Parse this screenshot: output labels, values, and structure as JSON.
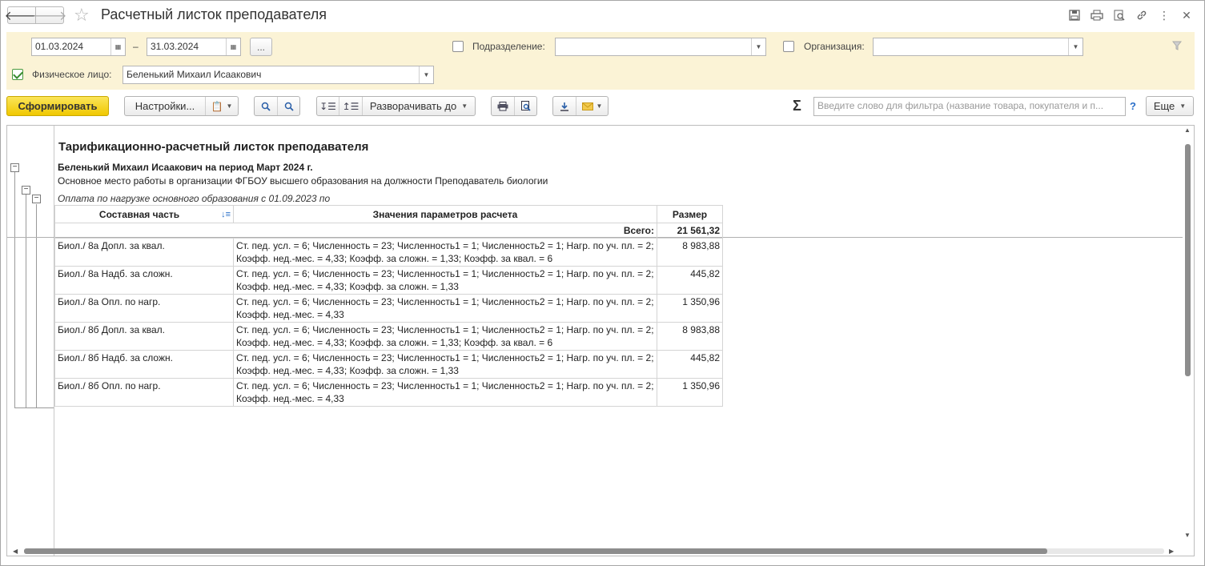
{
  "window": {
    "title": "Расчетный листок преподавателя"
  },
  "filters": {
    "date_from": "01.03.2024",
    "date_separator": "–",
    "date_to": "31.03.2024",
    "period_button": "...",
    "subdivision_label": "Подразделение:",
    "subdivision_value": "",
    "subdivision_checked": false,
    "organization_label": "Организация:",
    "organization_value": "",
    "organization_checked": false,
    "person_label": "Физическое лицо:",
    "person_value": "Беленький Михаил Исаакович",
    "person_checked": true
  },
  "toolbar": {
    "generate_label": "Сформировать",
    "settings_label": "Настройки...",
    "expand_label": "Разворачивать до",
    "search_placeholder": "Введите слово для фильтра (название товара, покупателя и п...",
    "help_label": "?",
    "more_label": "Еще"
  },
  "report": {
    "title": "Тарификационно-расчетный листок преподавателя",
    "subtitle": "Беленький Михаил Исаакович на период Март 2024 г.",
    "workplace": "Основное место работы в организации ФГБОУ высшего образования на должности Преподаватель биологии",
    "group": "Оплата по нагрузке основного образования с 01.09.2023 по",
    "columns": [
      "Составная часть",
      "Значения параметров расчета",
      "Размер"
    ],
    "total_label": "Всего:",
    "total_value": "21 561,32",
    "rows": [
      {
        "part": "Биол./ 8а Допл. за квал.",
        "params": "Ст. пед. усл. = 6; Численность = 23; Численность1 = 1; Численность2 = 1; Нагр. по уч. пл. = 2; Коэфф. нед.-мес. = 4,33; Коэфф. за сложн. = 1,33; Коэфф. за квал. = 6",
        "amount": "8 983,88"
      },
      {
        "part": "Биол./ 8а Надб. за сложн.",
        "params": "Ст. пед. усл. = 6; Численность = 23; Численность1 = 1; Численность2 = 1; Нагр. по уч. пл. = 2; Коэфф. нед.-мес. = 4,33; Коэфф. за сложн. = 1,33",
        "amount": "445,82"
      },
      {
        "part": "Биол./ 8а Опл. по нагр.",
        "params": "Ст. пед. усл. = 6; Численность = 23; Численность1 = 1; Численность2 = 1; Нагр. по уч. пл. = 2; Коэфф. нед.-мес. = 4,33",
        "amount": "1 350,96"
      },
      {
        "part": "Биол./ 8б Допл. за квал.",
        "params": "Ст. пед. усл. = 6; Численность = 23; Численность1 = 1; Численность2 = 1; Нагр. по уч. пл. = 2; Коэфф. нед.-мес. = 4,33; Коэфф. за сложн. = 1,33; Коэфф. за квал. = 6",
        "amount": "8 983,88"
      },
      {
        "part": "Биол./ 8б Надб. за сложн.",
        "params": "Ст. пед. усл. = 6; Численность = 23; Численность1 = 1; Численность2 = 1; Нагр. по уч. пл. = 2; Коэфф. нед.-мес. = 4,33; Коэфф. за сложн. = 1,33",
        "amount": "445,82"
      },
      {
        "part": "Биол./ 8б Опл. по нагр.",
        "params": "Ст. пед. усл. = 6; Численность = 23; Численность1 = 1; Численность2 = 1; Нагр. по уч. пл. = 2; Коэфф. нед.-мес. = 4,33",
        "amount": "1 350,96"
      }
    ]
  }
}
